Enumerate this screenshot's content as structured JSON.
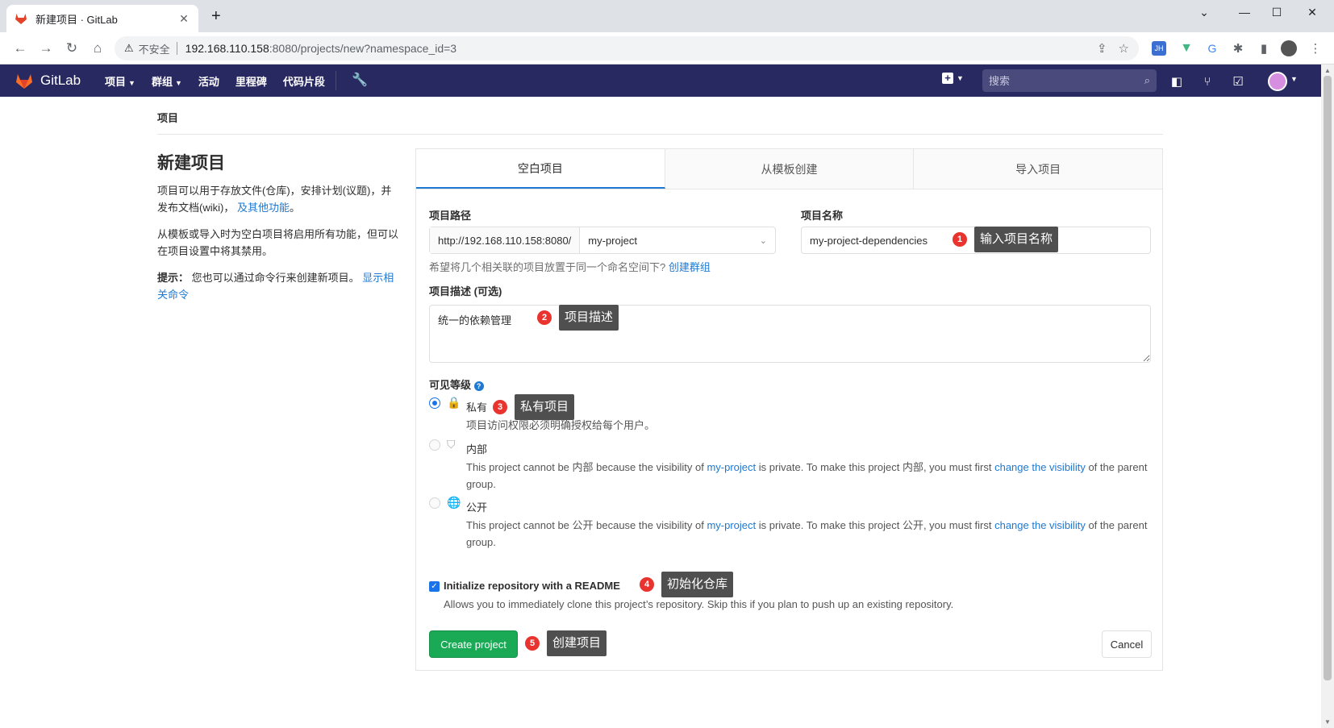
{
  "browser": {
    "tab_title": "新建项目 · GitLab",
    "insecure_label": "不安全",
    "url_host": "192.168.110.158",
    "url_rest": ":8080/projects/new?namespace_id=3"
  },
  "navbar": {
    "brand": "GitLab",
    "menu": [
      "项目",
      "群组",
      "活动",
      "里程碑",
      "代码片段"
    ],
    "search_placeholder": "搜索"
  },
  "breadcrumb": "项目",
  "sidebar": {
    "title": "新建项目",
    "p1": "项目可以用于存放文件(仓库)，安排计划(议题)，并发布文档(wiki)，",
    "p1_link": "及其他功能",
    "p1_end": "。",
    "p2": "从模板或导入时为空白项目将启用所有功能，但可以在项目设置中将其禁用。",
    "p3_label": "提示：",
    "p3": "您也可以通过命令行来创建新项目。",
    "p3_link": "显示相关命令"
  },
  "tabs": [
    "空白项目",
    "从模板创建",
    "导入项目"
  ],
  "form": {
    "path_label": "项目路径",
    "path_prefix": "http://192.168.110.158:8080/",
    "namespace": "my-project",
    "name_label": "项目名称",
    "name_value": "my-project-dependencies",
    "group_hint": "希望将几个相关联的项目放置于同一个命名空间下?",
    "group_link": "创建群组",
    "desc_label": "项目描述 (可选)",
    "desc_value": "统一的依赖管理",
    "visibility_label": "可见等级",
    "private_name": "私有",
    "private_desc": "项目访问权限必须明确授权给每个用户。",
    "internal_name": "内部",
    "internal_desc_1": "This project cannot be 内部 because the visibility of ",
    "internal_desc_link1": "my-project",
    "internal_desc_2": " is private. To make this project 内部, you must first ",
    "internal_desc_link2": "change the visibility",
    "internal_desc_3": " of the parent group.",
    "public_name": "公开",
    "public_desc_1": "This project cannot be 公开 because the visibility of ",
    "public_desc_link1": "my-project",
    "public_desc_2": " is private. To make this project 公开, you must first ",
    "public_desc_link2": "change the visibility",
    "public_desc_3": " of the parent group.",
    "readme_label": "Initialize repository with a README",
    "readme_hint": "Allows you to immediately clone this project’s repository. Skip this if you plan to push up an existing repository.",
    "create_button": "Create project",
    "cancel_button": "Cancel"
  },
  "annotations": [
    {
      "num": "1",
      "text": "输入项目名称"
    },
    {
      "num": "2",
      "text": "项目描述"
    },
    {
      "num": "3",
      "text": "私有项目"
    },
    {
      "num": "4",
      "text": "初始化仓库"
    },
    {
      "num": "5",
      "text": "创建项目"
    }
  ],
  "colors": {
    "navbar": "#292961",
    "primary_button": "#1aaa55",
    "link": "#1f78d1",
    "badge": "#e8332e"
  }
}
